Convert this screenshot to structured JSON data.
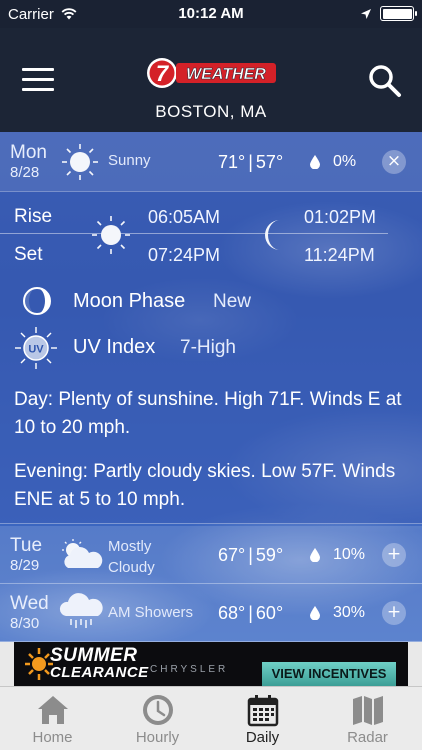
{
  "status_bar": {
    "carrier": "Carrier",
    "time": "10:12 AM"
  },
  "header": {
    "logo_number": "7",
    "logo_text": "WEATHER",
    "location": "BOSTON, MA",
    "menu_icon": "hamburger-menu-icon",
    "search_icon": "search-icon"
  },
  "today": {
    "day": "Mon",
    "date": "8/28",
    "condition": "Sunny",
    "high": "71°",
    "separator": "|",
    "low": "57°",
    "precip": "0%",
    "collapse_icon": "close-icon",
    "sun": {
      "rise_label": "Rise",
      "set_label": "Set",
      "sunrise": "06:05AM",
      "sunset": "07:24PM",
      "moonrise": "01:02PM",
      "moonset": "11:24PM"
    },
    "moon_phase": {
      "label": "Moon Phase",
      "value": "New"
    },
    "uv_index": {
      "label": "UV Index",
      "value": "7-High",
      "icon_text": "UV"
    },
    "day_text": "Day: Plenty of sunshine. High 71F. Winds E at 10 to 20 mph.",
    "evening_text": "Evening: Partly cloudy skies. Low 57F. Winds ENE at 5 to 10 mph."
  },
  "forecast": [
    {
      "day": "Tue",
      "date": "8/29",
      "condition_line1": "Mostly",
      "condition_line2": "Cloudy",
      "high": "67°",
      "separator": "|",
      "low": "59°",
      "precip": "10%",
      "icon": "partly-cloudy-icon"
    },
    {
      "day": "Wed",
      "date": "8/30",
      "condition_line1": "AM Showers",
      "condition_line2": "",
      "high": "68°",
      "separator": "|",
      "low": "60°",
      "precip": "30%",
      "icon": "showers-icon"
    }
  ],
  "ad": {
    "headline": "SUMMER",
    "subline": "CLEARANCE",
    "brand": "CHRYSLER",
    "cta": "VIEW INCENTIVES"
  },
  "tabs": [
    {
      "label": "Home",
      "icon": "home-icon",
      "active": false
    },
    {
      "label": "Hourly",
      "icon": "clock-icon",
      "active": false
    },
    {
      "label": "Daily",
      "icon": "calendar-icon",
      "active": true
    },
    {
      "label": "Radar",
      "icon": "map-icon",
      "active": false
    }
  ],
  "colors": {
    "header_bg": "#1c2536",
    "sky": "#2f55ad",
    "logo_red": "#d42128",
    "tab_active": "#222222",
    "tab_inactive": "#8c8c8c"
  }
}
